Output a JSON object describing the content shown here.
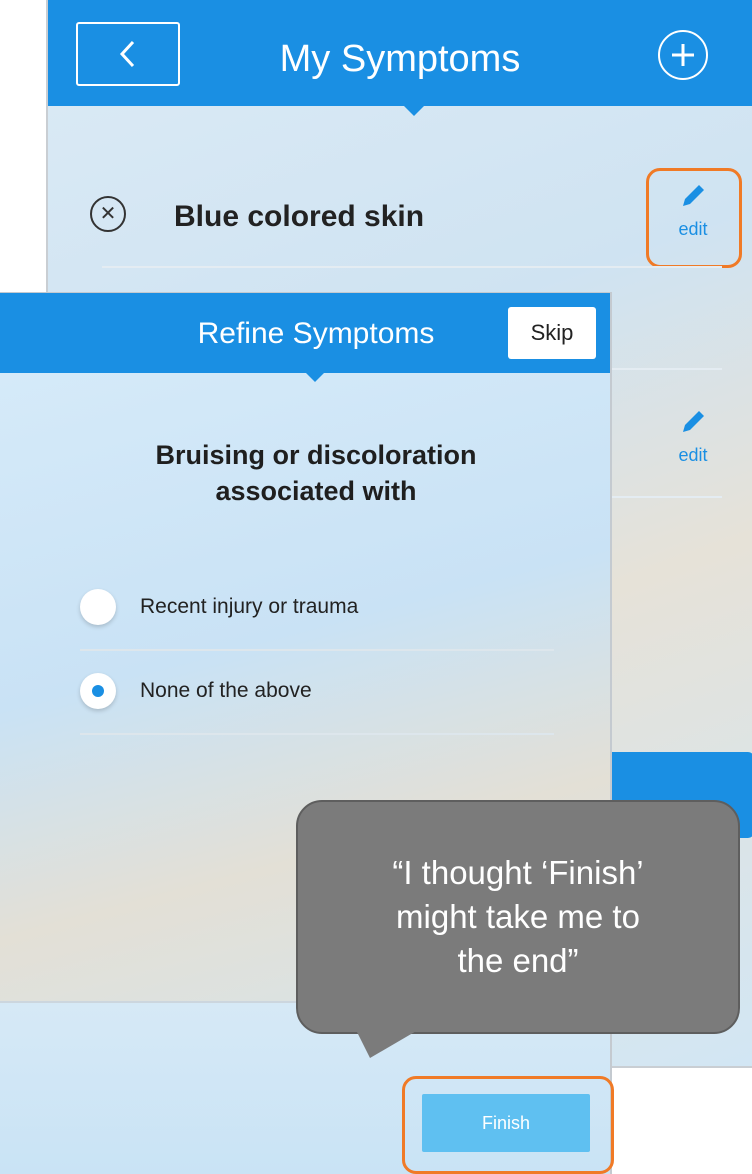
{
  "back_screen": {
    "title": "My Symptoms",
    "back_icon": "chevron-left-icon",
    "add_icon": "plus-circle-icon",
    "symptoms": [
      {
        "label": "Blue colored skin",
        "remove_icon": "close-icon",
        "edit_label": "edit"
      },
      {
        "label": "",
        "edit_label": "edit"
      }
    ]
  },
  "modal": {
    "title": "Refine Symptoms",
    "skip_label": "Skip",
    "question_line1": "Bruising or discoloration",
    "question_line2": "associated with",
    "options": [
      {
        "label": "Recent injury or trauma",
        "selected": false
      },
      {
        "label": "None of the above",
        "selected": true
      }
    ],
    "finish_label": "Finish"
  },
  "annotation": {
    "quote_line1": "“I thought ‘Finish’",
    "quote_line2": "might take me to",
    "quote_line3": "the end”",
    "highlight_color": "#f07a26"
  },
  "colors": {
    "brand_blue": "#1a8fe3",
    "finish_blue": "#5fc0f1",
    "bubble_gray": "#7b7b7b"
  }
}
